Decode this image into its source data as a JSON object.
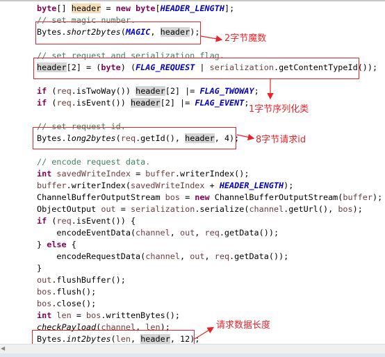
{
  "code_lines": [
    [
      [
        "kw",
        "byte"
      ],
      [
        "",
        "[] "
      ],
      [
        "decl",
        "header"
      ],
      [
        "",
        " = "
      ],
      [
        "kw",
        "new"
      ],
      [
        "",
        " "
      ],
      [
        "kw",
        "byte"
      ],
      [
        "",
        "["
      ],
      [
        "const",
        "HEADER_LENGTH"
      ],
      [
        "",
        "];"
      ]
    ],
    [
      [
        "cm",
        "// set magic number."
      ]
    ],
    [
      [
        "",
        "Bytes."
      ],
      [
        "it",
        "short2bytes"
      ],
      [
        "",
        "("
      ],
      [
        "const",
        "MAGIC"
      ],
      [
        "",
        ", "
      ],
      [
        "hl",
        "header"
      ],
      [
        "",
        ");"
      ]
    ],
    [],
    [
      [
        "cm",
        "// set request and serialization flag."
      ]
    ],
    [
      [
        "hl",
        "header"
      ],
      [
        "",
        "[2] = ("
      ],
      [
        "kw",
        "byte"
      ],
      [
        "",
        ") ("
      ],
      [
        "const",
        "FLAG_REQUEST"
      ],
      [
        "",
        " | "
      ],
      [
        "var",
        "serialization"
      ],
      [
        "",
        ".getContentTypeId());"
      ]
    ],
    [],
    [
      [
        "kw",
        "if"
      ],
      [
        "",
        " ("
      ],
      [
        "var",
        "req"
      ],
      [
        "",
        ".isTwoWay()) "
      ],
      [
        "hl",
        "header"
      ],
      [
        "",
        "[2] |= "
      ],
      [
        "const",
        "FLAG_TWOWAY"
      ],
      [
        "",
        ";"
      ]
    ],
    [
      [
        "kw",
        "if"
      ],
      [
        "",
        " ("
      ],
      [
        "var",
        "req"
      ],
      [
        "",
        ".isEvent()) "
      ],
      [
        "hl",
        "header"
      ],
      [
        "",
        "[2] |= "
      ],
      [
        "const",
        "FLAG_EVENT"
      ],
      [
        "",
        ";"
      ]
    ],
    [],
    [
      [
        "cm",
        "// set request id."
      ]
    ],
    [
      [
        "",
        "Bytes."
      ],
      [
        "it",
        "long2bytes"
      ],
      [
        "",
        "("
      ],
      [
        "var",
        "req"
      ],
      [
        "",
        ".getId(), "
      ],
      [
        "hl",
        "header"
      ],
      [
        "",
        ", 4);"
      ]
    ],
    [],
    [
      [
        "cm",
        "// encode request data."
      ]
    ],
    [
      [
        "kw",
        "int"
      ],
      [
        "",
        " "
      ],
      [
        "var",
        "savedWriteIndex"
      ],
      [
        "",
        " = "
      ],
      [
        "var",
        "buffer"
      ],
      [
        "",
        ".writerIndex();"
      ]
    ],
    [
      [
        "var",
        "buffer"
      ],
      [
        "",
        ".writerIndex("
      ],
      [
        "var",
        "savedWriteIndex"
      ],
      [
        "",
        " + "
      ],
      [
        "const",
        "HEADER_LENGTH"
      ],
      [
        "",
        ");"
      ]
    ],
    [
      [
        "",
        "ChannelBufferOutputStream "
      ],
      [
        "var",
        "bos"
      ],
      [
        "",
        " = "
      ],
      [
        "kw",
        "new"
      ],
      [
        "",
        " ChannelBufferOutputStream("
      ],
      [
        "var",
        "buffer"
      ],
      [
        "",
        ");"
      ]
    ],
    [
      [
        "",
        "ObjectOutput "
      ],
      [
        "var",
        "out"
      ],
      [
        "",
        " = "
      ],
      [
        "var",
        "serialization"
      ],
      [
        "",
        ".serialize("
      ],
      [
        "var",
        "channel"
      ],
      [
        "",
        ".getUrl(), "
      ],
      [
        "var",
        "bos"
      ],
      [
        "",
        ");"
      ]
    ],
    [
      [
        "kw",
        "if"
      ],
      [
        "",
        " ("
      ],
      [
        "var",
        "req"
      ],
      [
        "",
        ".isEvent()) {"
      ]
    ],
    [
      [
        "",
        "    encodeEventData("
      ],
      [
        "var",
        "channel"
      ],
      [
        "",
        ", "
      ],
      [
        "var",
        "out"
      ],
      [
        "",
        ", "
      ],
      [
        "var",
        "req"
      ],
      [
        "",
        ".getData());"
      ]
    ],
    [
      [
        "",
        "} "
      ],
      [
        "kw",
        "else"
      ],
      [
        "",
        " {"
      ]
    ],
    [
      [
        "",
        "    encodeRequestData("
      ],
      [
        "var",
        "channel"
      ],
      [
        "",
        ", "
      ],
      [
        "var",
        "out"
      ],
      [
        "",
        ", "
      ],
      [
        "var",
        "req"
      ],
      [
        "",
        ".getData());"
      ]
    ],
    [
      [
        "",
        "}"
      ]
    ],
    [
      [
        "var",
        "out"
      ],
      [
        "",
        ".flushBuffer();"
      ]
    ],
    [
      [
        "var",
        "bos"
      ],
      [
        "",
        ".flush();"
      ]
    ],
    [
      [
        "var",
        "bos"
      ],
      [
        "",
        ".close();"
      ]
    ],
    [
      [
        "kw",
        "int"
      ],
      [
        "",
        " "
      ],
      [
        "var",
        "len"
      ],
      [
        "",
        " = "
      ],
      [
        "var",
        "bos"
      ],
      [
        "",
        ".writtenBytes();"
      ]
    ],
    [
      [
        "it",
        "checkPayload"
      ],
      [
        "",
        "("
      ],
      [
        "var",
        "channel"
      ],
      [
        "",
        ", "
      ],
      [
        "var",
        "len"
      ],
      [
        "",
        ");"
      ]
    ],
    [
      [
        "",
        "Bytes."
      ],
      [
        "it",
        "int2bytes"
      ],
      [
        "",
        "("
      ],
      [
        "var",
        "len"
      ],
      [
        "",
        ", "
      ],
      [
        "hl",
        "header"
      ],
      [
        "",
        ", 12);"
      ]
    ]
  ],
  "annotations": {
    "magic": "2字节魔数",
    "serialization": "1字节序列化类",
    "request_id": "8字节请求id",
    "data_length": "请求数据长度"
  },
  "colors": {
    "annotation": "#e8242a",
    "keyword": "#7f0055",
    "constant": "#0000c0",
    "comment": "#3f7f5f",
    "variable": "#6a3e3e",
    "occurrence_highlight": "#d4d4d4"
  }
}
